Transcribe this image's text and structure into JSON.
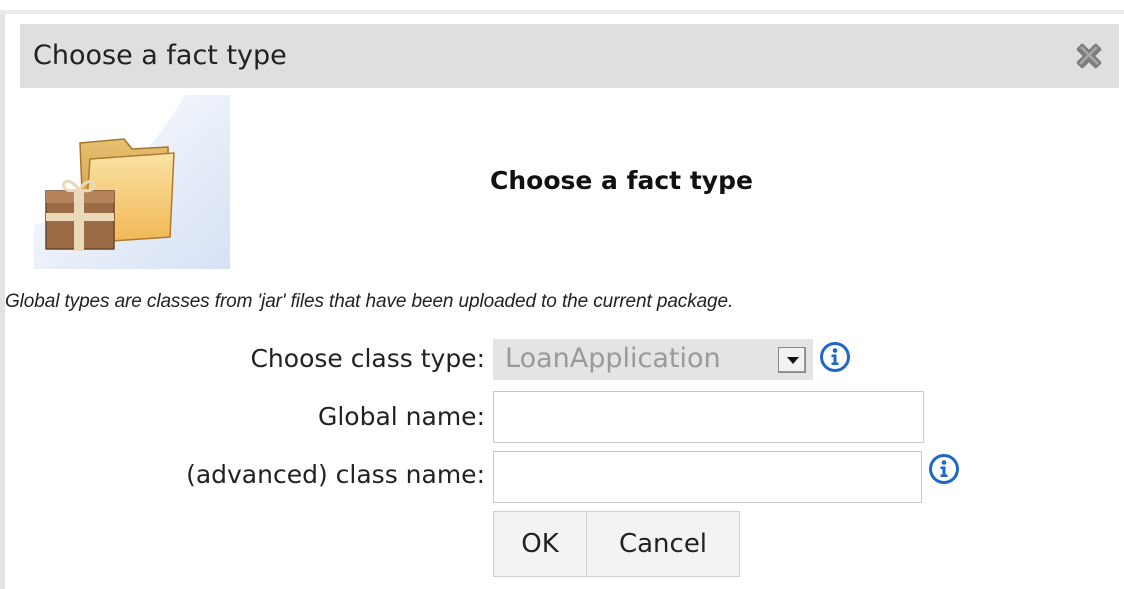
{
  "dialog": {
    "title": "Choose a fact type",
    "header_title": "Choose a fact type",
    "note": "Global types are classes from 'jar' files that have been uploaded to the current package.",
    "close_icon": "close-x-icon",
    "header_icon": "folder-package-icon"
  },
  "form": {
    "class_type_label": "Choose class type:",
    "class_type_value": "LoanApplication",
    "global_name_label": "Global name:",
    "global_name_value": "",
    "advanced_label": "(advanced) class name:",
    "advanced_value": "",
    "info_icon": "info-icon"
  },
  "buttons": {
    "ok": "OK",
    "cancel": "Cancel"
  },
  "colors": {
    "titlebar": "#dfdfdf",
    "info_blue": "#1f66c8",
    "select_bg": "#e4e4e4"
  }
}
